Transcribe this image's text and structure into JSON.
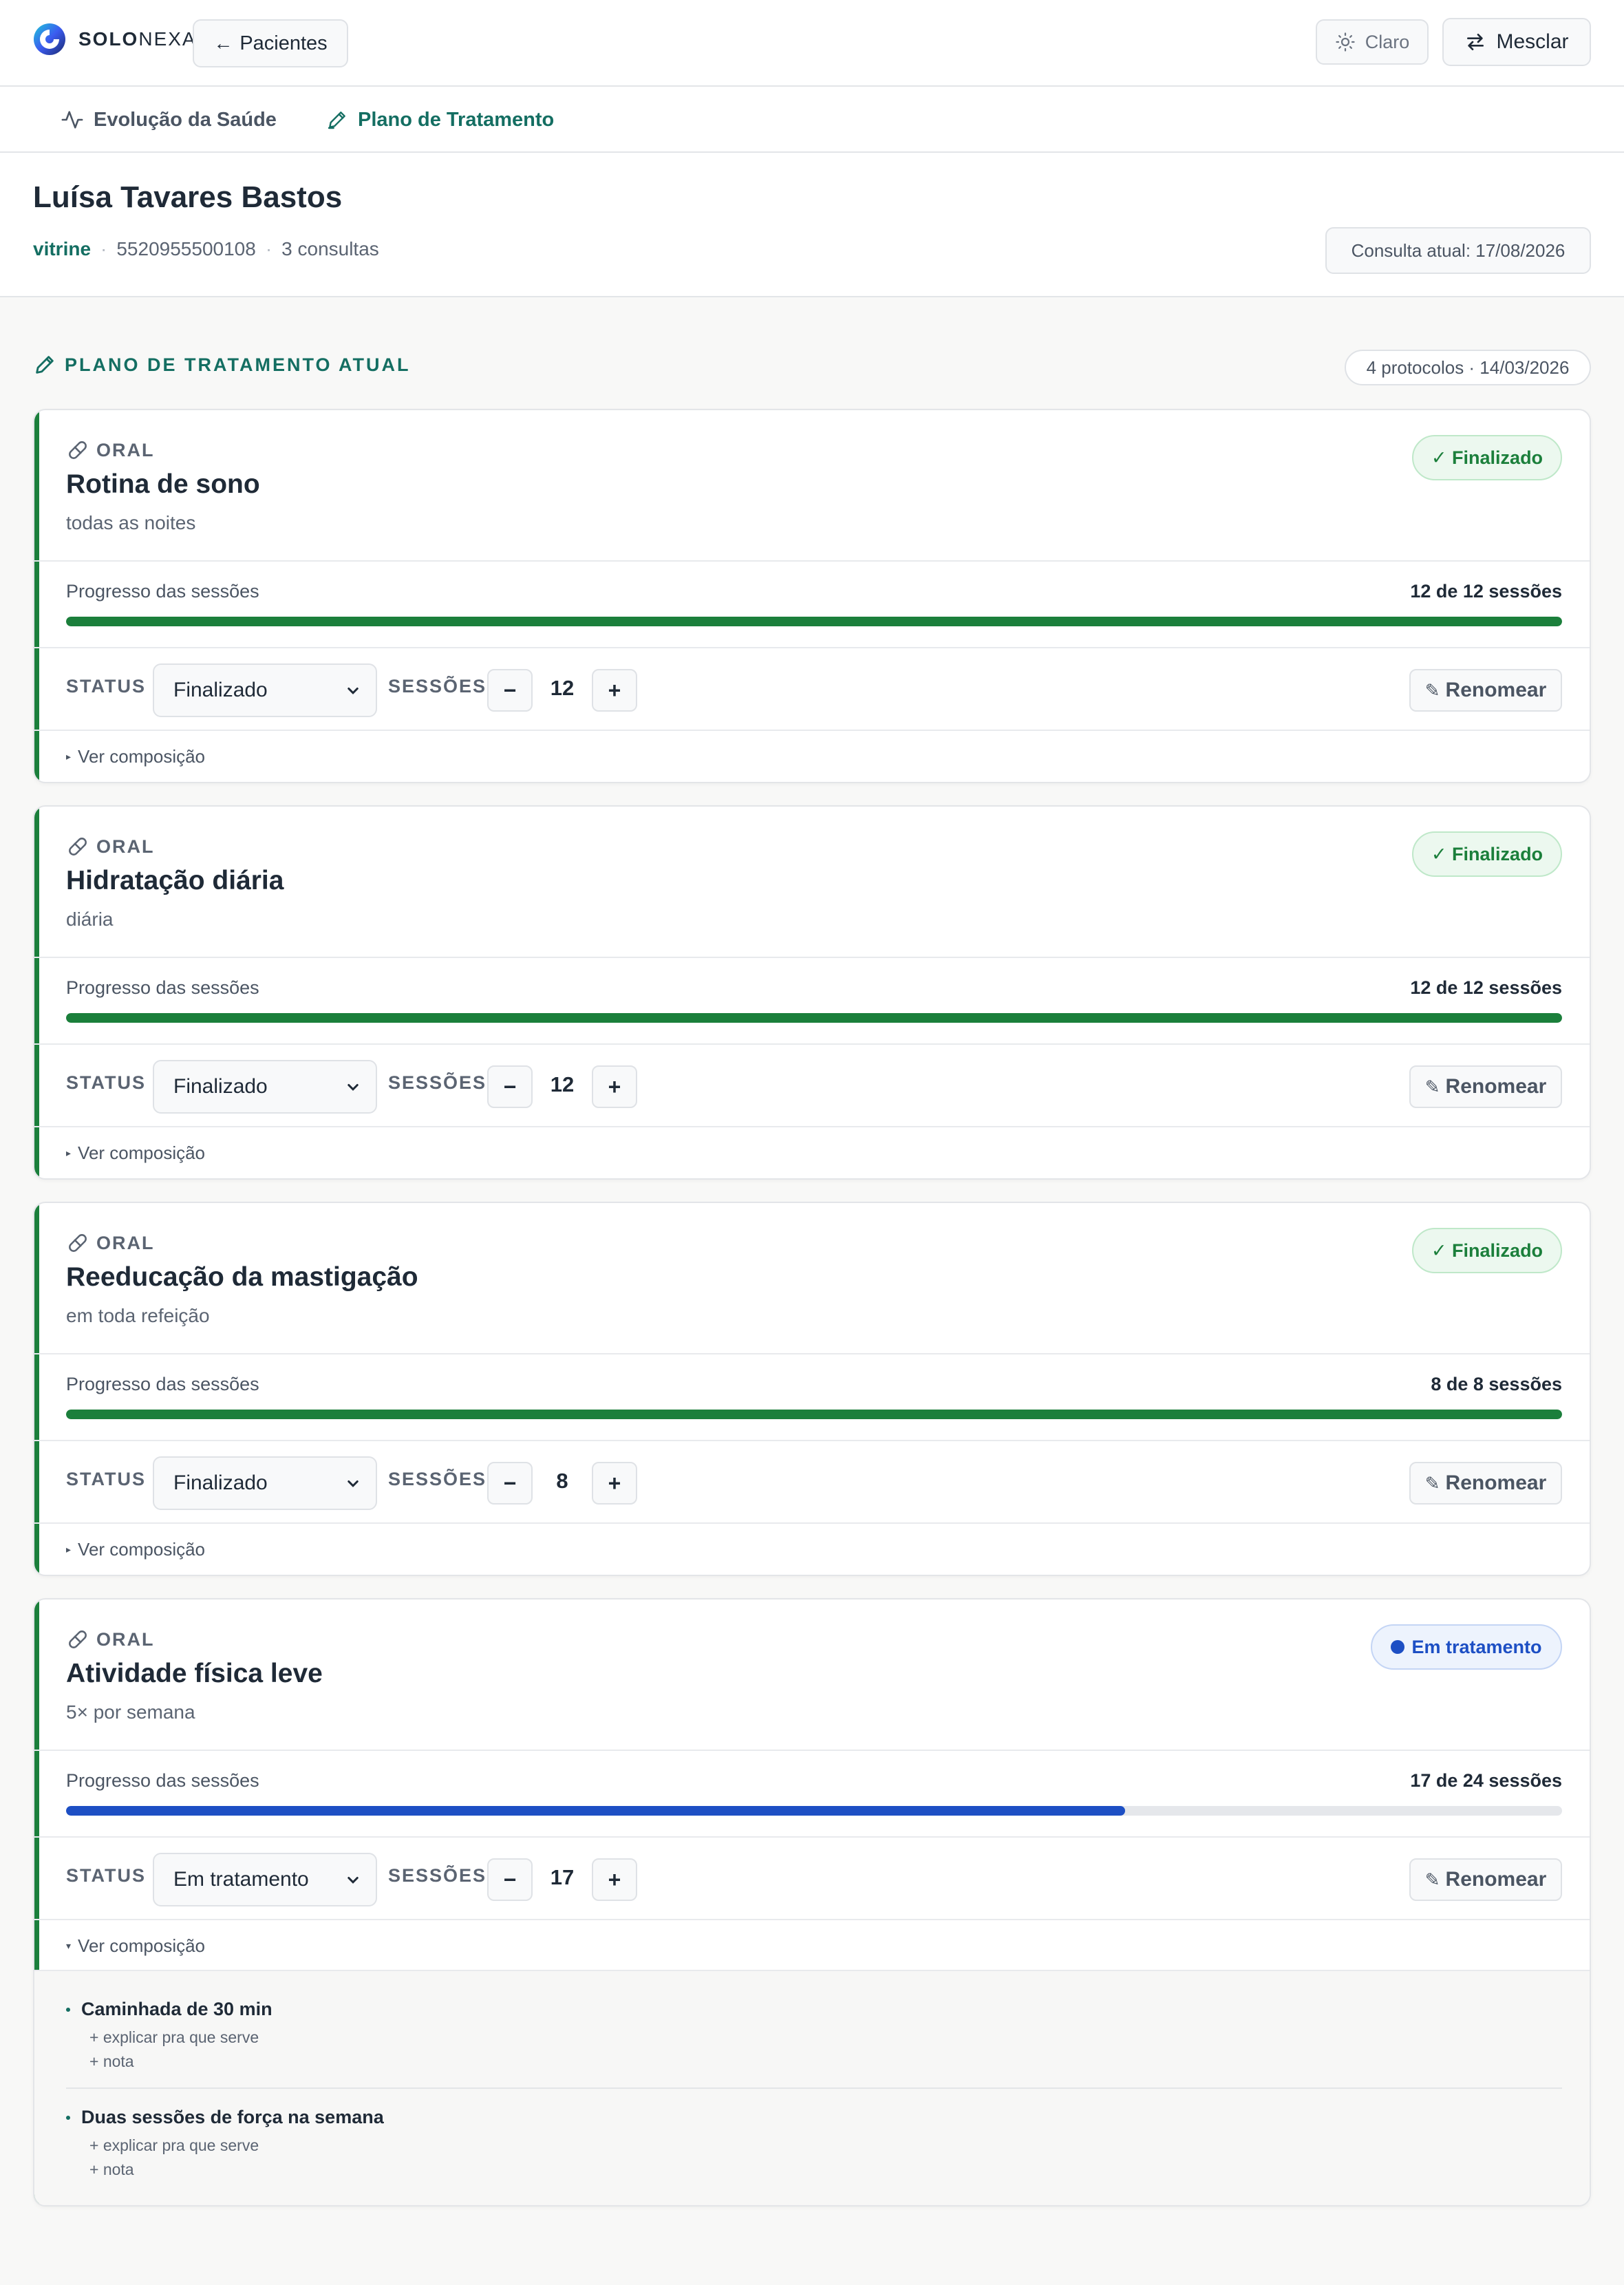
{
  "header": {
    "logo_bold": "SOLO",
    "logo_light": "NEXA",
    "back_label": "Pacientes",
    "theme_label": "Claro",
    "merge_label": "Mesclar"
  },
  "tabs": [
    {
      "label": "Evolução da Saúde",
      "icon": "activity-icon"
    },
    {
      "label": "Plano de Tratamento",
      "icon": "pencil-icon",
      "active": true
    }
  ],
  "patient": {
    "name": "Luísa Tavares Bastos",
    "tag": "vitrine",
    "phone": "5520955500108",
    "consultas": "3 consultas",
    "current_consult": "Consulta atual: 17/08/2026"
  },
  "plan": {
    "section_title": "PLANO DE TRATAMENTO ATUAL",
    "summary": "4 protocolos · 14/03/2026",
    "progress_label": "Progresso das sessões",
    "status_label": "STATUS",
    "sessions_label": "SESSÕES",
    "rename_label": "Renomear",
    "compose_label": "Ver composição",
    "protocols": [
      {
        "route": "ORAL",
        "title": "Rotina de sono",
        "frequency": "todas as noites",
        "status_pill": "Finalizado",
        "progress_text": "12 de 12 sessões",
        "progress_fraction": 1.0,
        "status_value": "Finalizado",
        "sessions": "12"
      },
      {
        "route": "ORAL",
        "title": "Hidratação diária",
        "frequency": "diária",
        "status_pill": "Finalizado",
        "progress_text": "12 de 12 sessões",
        "progress_fraction": 1.0,
        "status_value": "Finalizado",
        "sessions": "12"
      },
      {
        "route": "ORAL",
        "title": "Reeducação da mastigação",
        "frequency": "em toda refeição",
        "status_pill": "Finalizado",
        "progress_text": "8 de 8 sessões",
        "progress_fraction": 1.0,
        "status_value": "Finalizado",
        "sessions": "8"
      },
      {
        "route": "ORAL",
        "title": "Atividade física leve",
        "frequency": "5× por semana",
        "status_pill": "Em tratamento",
        "progress_text": "17 de 24 sessões",
        "progress_fraction": 0.708,
        "status_value": "Em tratamento",
        "sessions": "17",
        "composition": [
          {
            "name": "Caminhada de 30 min",
            "add_explain": "+ explicar pra que serve",
            "add_note": "+ nota"
          },
          {
            "name": "Duas sessões de força na semana",
            "add_explain": "+ explicar pra que serve",
            "add_note": "+ nota"
          }
        ]
      }
    ]
  },
  "colors": {
    "accent": "#146e62",
    "done": "#1b7f3b",
    "active": "#1d4fc4"
  }
}
